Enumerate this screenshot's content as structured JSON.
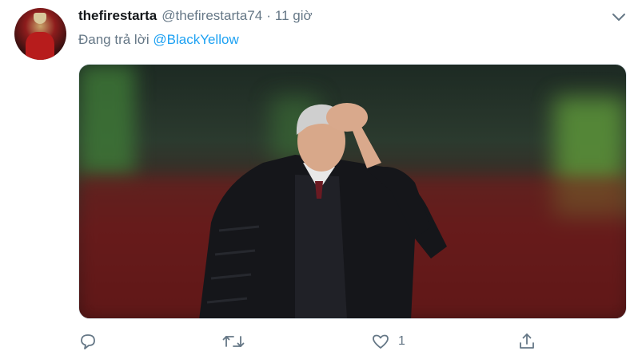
{
  "tweet": {
    "display_name": "thefirestarta",
    "handle": "@thefirestarta74",
    "separator": "·",
    "time": "11 giờ",
    "reply_prefix": "Đang trả lời",
    "reply_mention": "@BlackYellow"
  },
  "actions": {
    "reply_icon": "reply-icon",
    "retweet_icon": "retweet-icon",
    "like_icon": "heart-icon",
    "like_count": "1",
    "share_icon": "share-icon"
  },
  "colors": {
    "link": "#1da1f2",
    "secondary_text": "#657786",
    "primary_text": "#14171a"
  }
}
